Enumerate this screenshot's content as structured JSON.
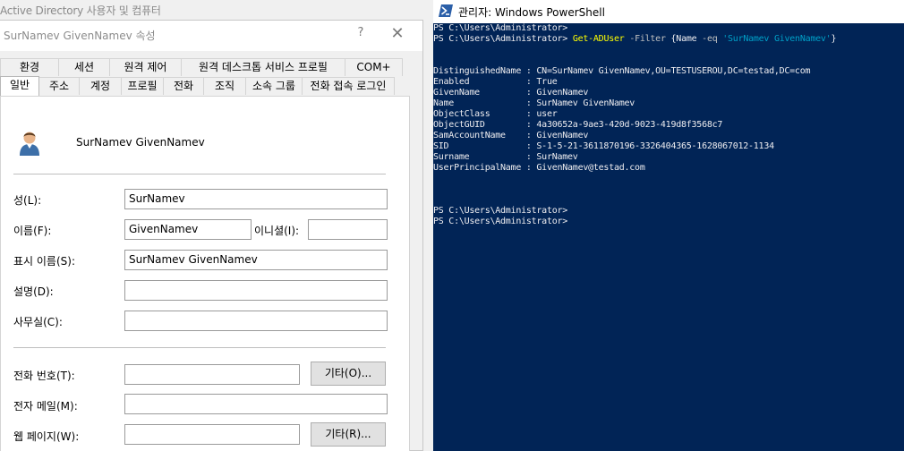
{
  "background_window": {
    "title": "Active Directory 사용자 및 컴퓨터"
  },
  "dialog": {
    "title": "SurNamev GivenNamev 속성",
    "help_label": "?",
    "close_label": "✕",
    "tabs_row1": [
      "환경",
      "세션",
      "원격 제어",
      "원격 데스크톱 서비스 프로필",
      "COM+"
    ],
    "tabs_row2": [
      "일반",
      "주소",
      "계정",
      "프로필",
      "전화",
      "조직",
      "소속 그룹",
      "전화 접속 로그인"
    ],
    "active_tab": "일반",
    "user_display": "SurNamev GivenNamev",
    "fields": {
      "last_name_label": "성(L):",
      "last_name_value": "SurNamev",
      "first_name_label": "이름(F):",
      "first_name_value": "GivenNamev",
      "initials_label": "이니셜(I):",
      "initials_value": "",
      "display_name_label": "표시 이름(S):",
      "display_name_value": "SurNamev GivenNamev",
      "description_label": "설명(D):",
      "description_value": "",
      "office_label": "사무실(C):",
      "office_value": "",
      "phone_label": "전화 번호(T):",
      "phone_value": "",
      "phone_other_button": "기타(O)...",
      "email_label": "전자 메일(M):",
      "email_value": "",
      "web_label": "웹 페이지(W):",
      "web_value": "",
      "web_other_button": "기타(R)..."
    }
  },
  "powershell": {
    "title": "관리자: Windows PowerShell",
    "prompt": "PS C:\\Users\\Administrator>",
    "command": {
      "cmdlet": "Get-ADUser",
      "param": "-Filter",
      "brace_open": "{",
      "prop": "Name",
      "op": "-eq",
      "value": "'SurNamev GivenNamev'",
      "brace_close": "}"
    },
    "output": [
      "DistinguishedName : CN=SurNamev GivenNamev,OU=TESTUSEROU,DC=testad,DC=com",
      "Enabled           : True",
      "GivenName         : GivenNamev",
      "Name              : SurNamev GivenNamev",
      "ObjectClass       : user",
      "ObjectGUID        : 4a30652a-9ae3-420d-9023-419d8f3568c7",
      "SamAccountName    : GivenNamev",
      "SID               : S-1-5-21-3611870196-3326404365-1628067012-1134",
      "Surname           : SurNamev",
      "UserPrincipalName : GivenNamev@testad.com"
    ]
  },
  "colors": {
    "ps_background": "#012456",
    "ps_text": "#eeedf0",
    "ps_cmdlet": "#ffff00",
    "ps_param": "#c0c0c0",
    "ps_string": "#00a0c8",
    "dialog_bg": "#f0f0f0"
  },
  "icons": {
    "user": "user-icon",
    "powershell": "powershell-icon",
    "close": "close-icon",
    "help": "help-icon"
  }
}
